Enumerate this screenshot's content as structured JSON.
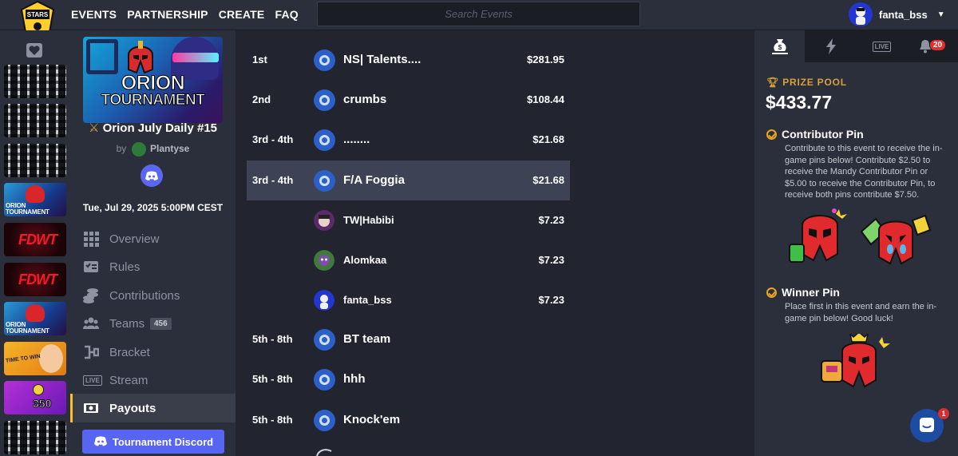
{
  "header": {
    "logo": "brawl-stars-logo",
    "nav": [
      "EVENTS",
      "PARTNERSHIP",
      "CREATE",
      "FAQ"
    ],
    "search_placeholder": "Search Events",
    "username": "fanta_bss"
  },
  "event": {
    "banner_line1": "ORION",
    "banner_line2": "TOURNAMENT",
    "title": "Orion July Daily #15",
    "by_label": "by",
    "organizer": "Plantyse",
    "date": "Tue, Jul 29, 2025 5:00PM CEST",
    "discord_button": "Tournament Discord"
  },
  "event_strip": [
    {
      "kind": "grey"
    },
    {
      "kind": "grey"
    },
    {
      "kind": "grey"
    },
    {
      "kind": "orion",
      "text": "ORION TOURNAMENT"
    },
    {
      "kind": "fdwt",
      "text": "FDWT"
    },
    {
      "kind": "fdwt",
      "text": "FDWT"
    },
    {
      "kind": "orion",
      "text": "ORION TOURNAMENT"
    },
    {
      "kind": "time",
      "text": "TIME TO WIN"
    },
    {
      "kind": "350",
      "text": "350"
    },
    {
      "kind": "grey"
    }
  ],
  "menu": [
    {
      "label": "Overview",
      "icon": "grid-icon"
    },
    {
      "label": "Rules",
      "icon": "rules-icon"
    },
    {
      "label": "Contributions",
      "icon": "coins-icon"
    },
    {
      "label": "Teams",
      "icon": "users-icon",
      "badge": "456"
    },
    {
      "label": "Bracket",
      "icon": "bracket-icon"
    },
    {
      "label": "Stream",
      "icon": "live-icon",
      "icon_text": "LIVE"
    },
    {
      "label": "Payouts",
      "icon": "money-icon",
      "active": true
    }
  ],
  "payouts": [
    {
      "place": "1st",
      "team": "NS| Talents....",
      "amount": "$281.95",
      "type": "team"
    },
    {
      "place": "2nd",
      "team": "crumbs",
      "amount": "$108.44",
      "type": "team"
    },
    {
      "place": "3rd - 4th",
      "team": "........",
      "amount": "$21.68",
      "type": "team"
    },
    {
      "place": "3rd - 4th",
      "team": "F/A Foggia",
      "amount": "$21.68",
      "type": "team",
      "highlight": true
    },
    {
      "place": "",
      "team": "TW|Habibi",
      "amount": "$7.23",
      "type": "player",
      "color": "#5b2a6b"
    },
    {
      "place": "",
      "team": "Alomkaa",
      "amount": "$7.23",
      "type": "player",
      "color": "#3f7a3a"
    },
    {
      "place": "",
      "team": "fanta_bss",
      "amount": "$7.23",
      "type": "player",
      "color": "#2336d1"
    },
    {
      "place": "5th - 8th",
      "team": "BT team",
      "amount": "",
      "type": "team"
    },
    {
      "place": "5th - 8th",
      "team": "hhh",
      "amount": "",
      "type": "team"
    },
    {
      "place": "5th - 8th",
      "team": "Knock'em",
      "amount": "",
      "type": "team"
    }
  ],
  "right_panel": {
    "tabs": [
      "money-bag-icon",
      "lightning-icon",
      "live-icon",
      "bell-icon"
    ],
    "live_text": "LIVE",
    "notifications": "20",
    "prize_label": "PRIZE POOL",
    "prize_amount": "$433.77",
    "contributor_title": "Contributor Pin",
    "contributor_text": "Contribute to this event to receive the in-game pins below! Contribute $2.50 to receive the Mandy Contributor Pin or $5.00 to receive the Contributor Pin, to receive both pins contribute $7.50.",
    "winner_title": "Winner Pin",
    "winner_text": "Place first in this event and earn the in-game pin below! Good luck!"
  },
  "chat": {
    "badge": "1"
  },
  "colors": {
    "accent": "#ffbe2b",
    "discord": "#5865f2",
    "team_icon": "#2d5fc9",
    "highlight_row": "#3d4354"
  }
}
